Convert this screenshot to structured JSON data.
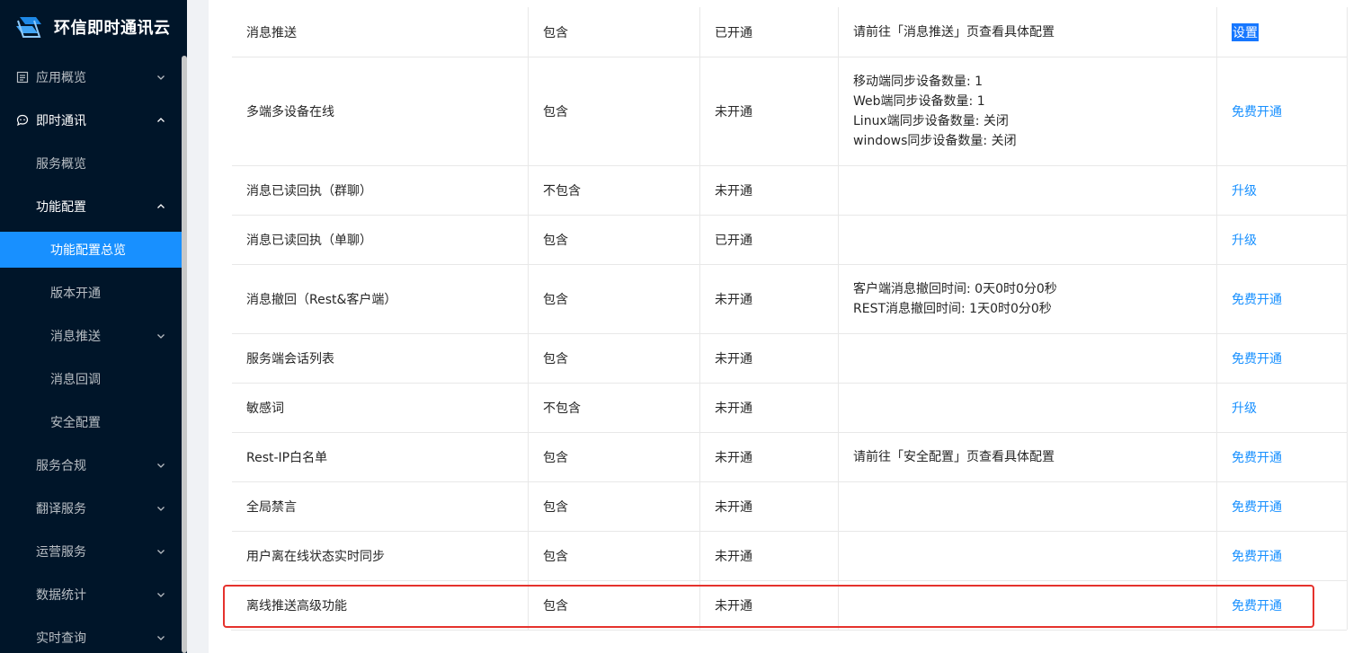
{
  "app": {
    "title": "环信即时通讯云"
  },
  "sidebar": {
    "items": [
      {
        "label": "应用概览",
        "level": 1,
        "icon": "document-icon",
        "chevron": "down"
      },
      {
        "label": "即时通讯",
        "level": 1,
        "icon": "chat-icon",
        "chevron": "up",
        "open": true
      },
      {
        "label": "服务概览",
        "level": 2
      },
      {
        "label": "功能配置",
        "level": 2,
        "chevron": "up",
        "open": true
      },
      {
        "label": "功能配置总览",
        "level": 3,
        "selected": true
      },
      {
        "label": "版本开通",
        "level": 3
      },
      {
        "label": "消息推送",
        "level": 3,
        "chevron": "down"
      },
      {
        "label": "消息回调",
        "level": 3
      },
      {
        "label": "安全配置",
        "level": 3
      },
      {
        "label": "服务合规",
        "level": 2,
        "chevron": "down"
      },
      {
        "label": "翻译服务",
        "level": 2,
        "chevron": "down"
      },
      {
        "label": "运营服务",
        "level": 2,
        "chevron": "down"
      },
      {
        "label": "数据统计",
        "level": 2,
        "chevron": "down"
      },
      {
        "label": "实时查询",
        "level": 2,
        "chevron": "down"
      }
    ]
  },
  "table": {
    "rows": [
      {
        "feature": "消息推送",
        "included": "包含",
        "status": "已开通",
        "details": [
          "请前往「消息推送」页查看具体配置"
        ],
        "action": "设置",
        "action_selected": true
      },
      {
        "feature": "多端多设备在线",
        "included": "包含",
        "status": "未开通",
        "details": [
          "移动端同步设备数量: 1",
          "Web端同步设备数量: 1",
          "Linux端同步设备数量: 关闭",
          "windows同步设备数量: 关闭"
        ],
        "action": "免费开通"
      },
      {
        "feature": "消息已读回执（群聊）",
        "included": "不包含",
        "status": "未开通",
        "details": [],
        "action": "升级"
      },
      {
        "feature": "消息已读回执（单聊）",
        "included": "包含",
        "status": "已开通",
        "details": [],
        "action": "升级"
      },
      {
        "feature": "消息撤回（Rest&客户端）",
        "included": "包含",
        "status": "未开通",
        "details": [
          "客户端消息撤回时间: 0天0时0分0秒",
          "REST消息撤回时间: 1天0时0分0秒"
        ],
        "action": "免费开通"
      },
      {
        "feature": "服务端会话列表",
        "included": "包含",
        "status": "未开通",
        "details": [],
        "action": "免费开通"
      },
      {
        "feature": "敏感词",
        "included": "不包含",
        "status": "未开通",
        "details": [],
        "action": "升级"
      },
      {
        "feature": "Rest-IP白名单",
        "included": "包含",
        "status": "未开通",
        "details": [
          "请前往「安全配置」页查看具体配置"
        ],
        "action": "免费开通"
      },
      {
        "feature": "全局禁言",
        "included": "包含",
        "status": "未开通",
        "details": [],
        "action": "免费开通"
      },
      {
        "feature": "用户离在线状态实时同步",
        "included": "包含",
        "status": "未开通",
        "details": [],
        "action": "免费开通"
      },
      {
        "feature": "离线推送高级功能",
        "included": "包含",
        "status": "未开通",
        "details": [],
        "action": "免费开通",
        "highlighted": true
      }
    ]
  },
  "colors": {
    "sidebar_bg": "#001529",
    "selected_bg": "#1890ff",
    "link": "#1890ff",
    "highlight_border": "#e5322d"
  }
}
